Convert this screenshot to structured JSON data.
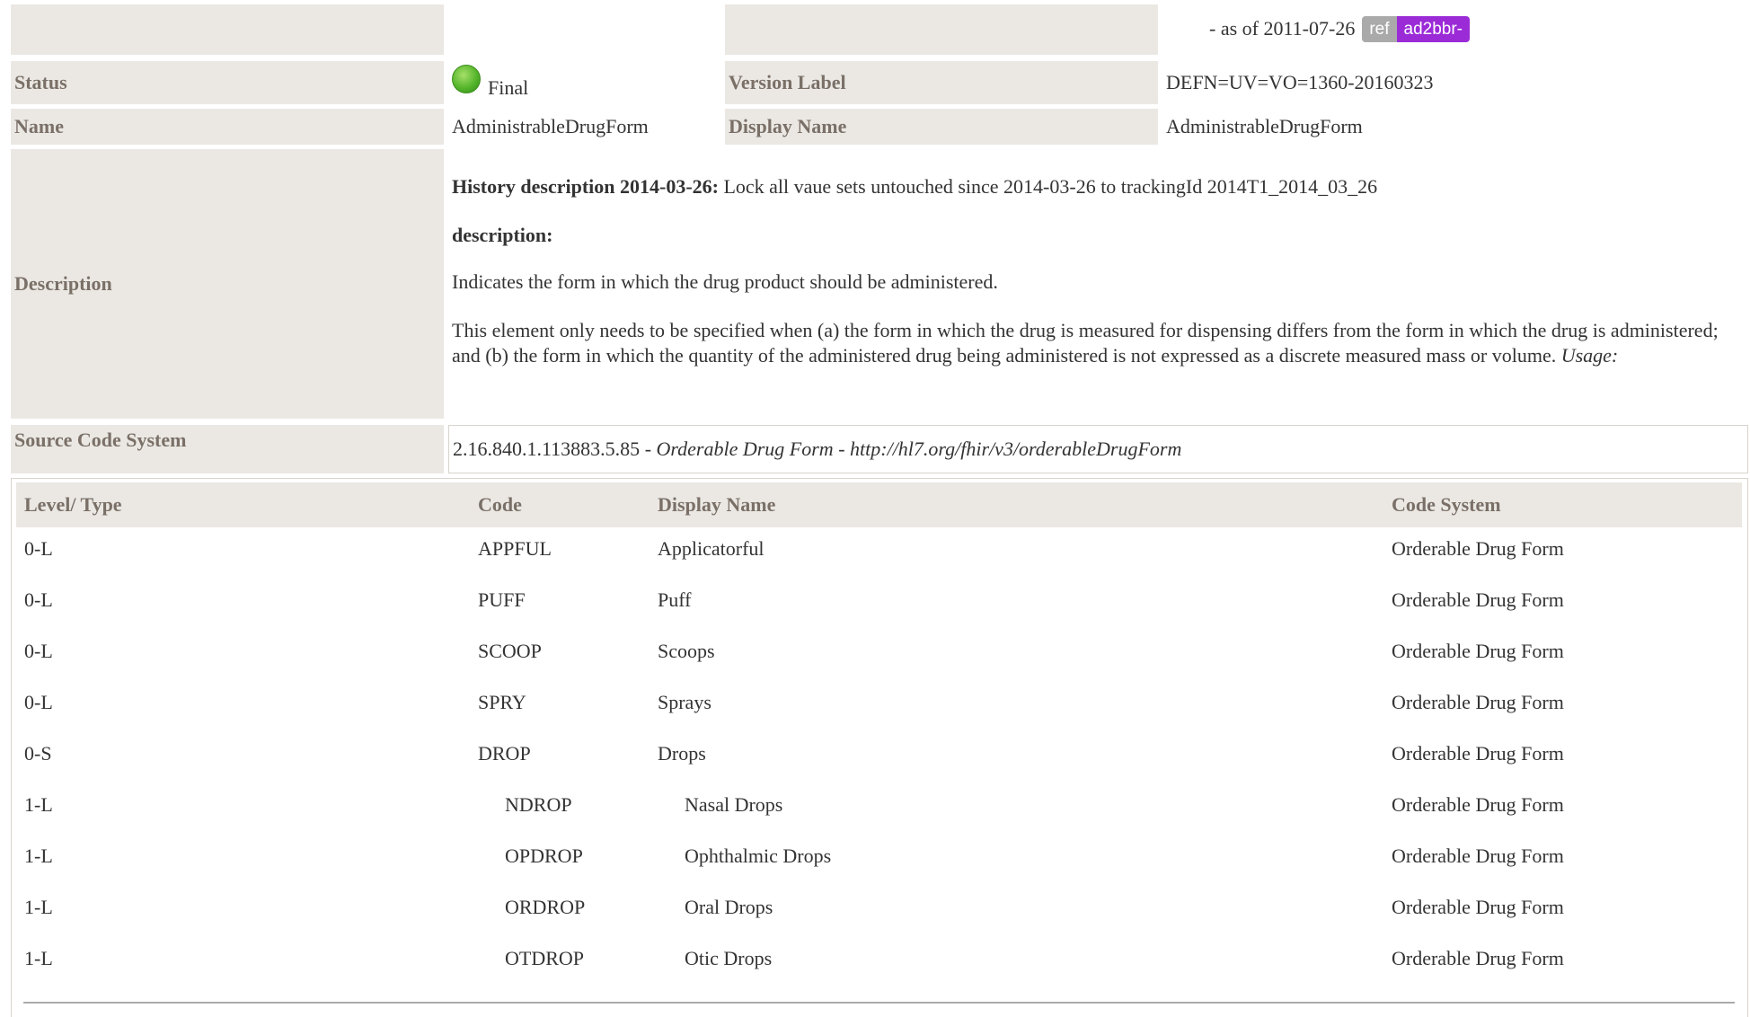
{
  "header": {
    "as_of": "- as of 2011-07-26",
    "ref_badge": "ref",
    "ref_code": "ad2bbr-"
  },
  "status": {
    "label": "Status",
    "value": "Final"
  },
  "version_label": {
    "label": "Version Label",
    "value": "DEFN=UV=VO=1360-20160323"
  },
  "name": {
    "label": "Name",
    "value": "AdministrableDrugForm"
  },
  "display_name": {
    "label": "Display Name",
    "value": "AdministrableDrugForm"
  },
  "description": {
    "label": "Description",
    "history_heading": "History description 2014-03-26:",
    "history_text": " Lock all vaue sets untouched since 2014-03-26 to trackingId 2014T1_2014_03_26",
    "desc_heading": "description:",
    "para1": "Indicates the form in which the drug product should be administered.",
    "para2": "This element only needs to be specified when (a) the form in which the drug is measured for dispensing differs from the form in which the drug is administered; and (b) the form in which the quantity of the administered drug being administered is not expressed as a discrete measured mass or volume. ",
    "usage": "Usage:"
  },
  "source_code_system": {
    "label": "Source Code System",
    "oid": "2.16.840.1.113883.5.85",
    "sep": " - ",
    "name": "Orderable Drug Form",
    "url": "http://hl7.org/fhir/v3/orderableDrugForm"
  },
  "table": {
    "headers": [
      "Level/ Type",
      "Code",
      "Display Name",
      "Code System"
    ],
    "rows": [
      {
        "level": "0-L",
        "code": "APPFUL",
        "display": "Applicatorful",
        "system": "Orderable Drug Form"
      },
      {
        "level": "0-L",
        "code": "PUFF",
        "display": "Puff",
        "system": "Orderable Drug Form"
      },
      {
        "level": "0-L",
        "code": "SCOOP",
        "display": "Scoops",
        "system": "Orderable Drug Form"
      },
      {
        "level": "0-L",
        "code": "SPRY",
        "display": "Sprays",
        "system": "Orderable Drug Form"
      },
      {
        "level": "0-S",
        "code": "DROP",
        "display": "Drops",
        "system": "Orderable Drug Form"
      },
      {
        "level": "1-L",
        "code": "NDROP",
        "display": "Nasal Drops",
        "system": "Orderable Drug Form"
      },
      {
        "level": "1-L",
        "code": "OPDROP",
        "display": "Ophthalmic Drops",
        "system": "Orderable Drug Form"
      },
      {
        "level": "1-L",
        "code": "ORDROP",
        "display": "Oral Drops",
        "system": "Orderable Drug Form"
      },
      {
        "level": "1-L",
        "code": "OTDROP",
        "display": "Otic Drops",
        "system": "Orderable Drug Form"
      }
    ]
  },
  "colors": {
    "label_bg": "#ebe8e3",
    "label_text": "#7a7068",
    "badge_ref": "#aaaaaa",
    "badge_code": "#9b2bd6",
    "status_dot": "#55b52b"
  },
  "icons": {
    "status": "status-final-dot-icon"
  }
}
